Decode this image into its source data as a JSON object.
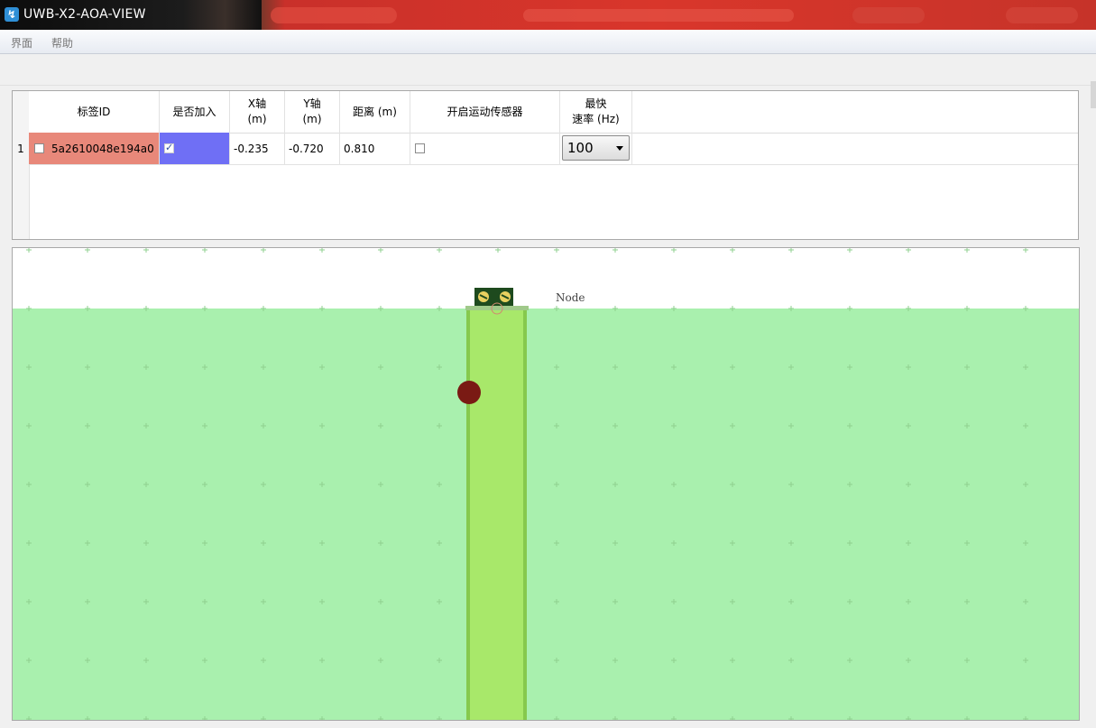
{
  "window": {
    "title": "UWB-X2-AOA-VIEW",
    "icon": "app-logo-icon"
  },
  "menu": {
    "items": [
      {
        "label": "界面"
      },
      {
        "label": "帮助"
      }
    ]
  },
  "table": {
    "columns": [
      {
        "label": "标签ID"
      },
      {
        "label": "是否加入"
      },
      {
        "label": "X轴\n(m)"
      },
      {
        "label": "Y轴\n(m)"
      },
      {
        "label": "距离 (m)"
      },
      {
        "label": "开启运动传感器"
      },
      {
        "label": "最快\n速率 (Hz)"
      }
    ],
    "rows": [
      {
        "index": "1",
        "tag_id": "5a2610048e194a0",
        "selected": false,
        "joined": true,
        "x": "-0.235",
        "y": "-0.720",
        "distance": "0.810",
        "motion_sensor": false,
        "rate": "100"
      }
    ]
  },
  "canvas": {
    "node_label": "Node",
    "colors": {
      "coverage": "#a9f0ae",
      "beam": "#a8e86a",
      "beam_border": "#86c94d",
      "tag": "#7a1a14",
      "grid_mark": "#8fd08f",
      "row_highlight": "#e8887a",
      "joined_highlight": "#6f6ff5"
    }
  }
}
